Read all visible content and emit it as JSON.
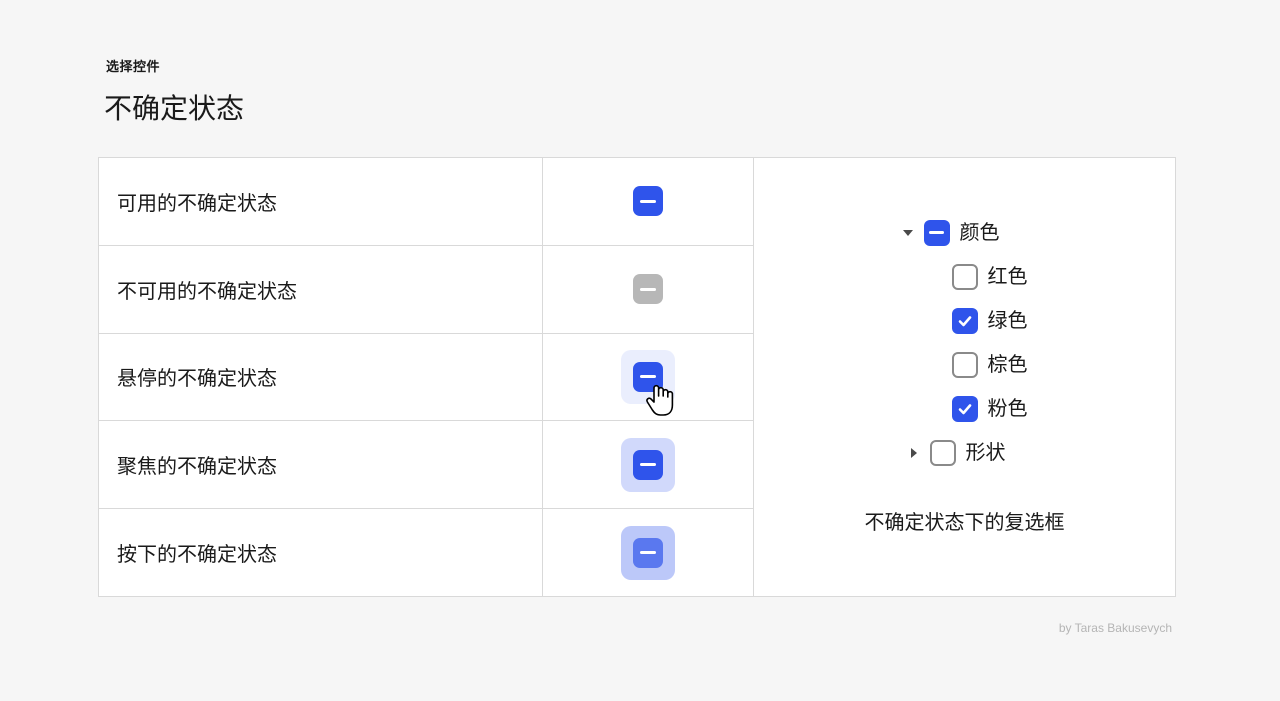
{
  "eyebrow": "选择控件",
  "title": "不确定状态",
  "states": [
    {
      "label": "可用的不确定状态"
    },
    {
      "label": "不可用的不确定状态"
    },
    {
      "label": "悬停的不确定状态"
    },
    {
      "label": "聚焦的不确定状态"
    },
    {
      "label": "按下的不确定状态"
    }
  ],
  "tree": {
    "parent_color": "颜色",
    "children": [
      {
        "label": "红色",
        "checked": false
      },
      {
        "label": "绿色",
        "checked": true
      },
      {
        "label": "棕色",
        "checked": false
      },
      {
        "label": "粉色",
        "checked": true
      }
    ],
    "sibling_shape": "形状"
  },
  "example_caption": "不确定状态下的复选框",
  "credit": "by Taras Bakusevych"
}
